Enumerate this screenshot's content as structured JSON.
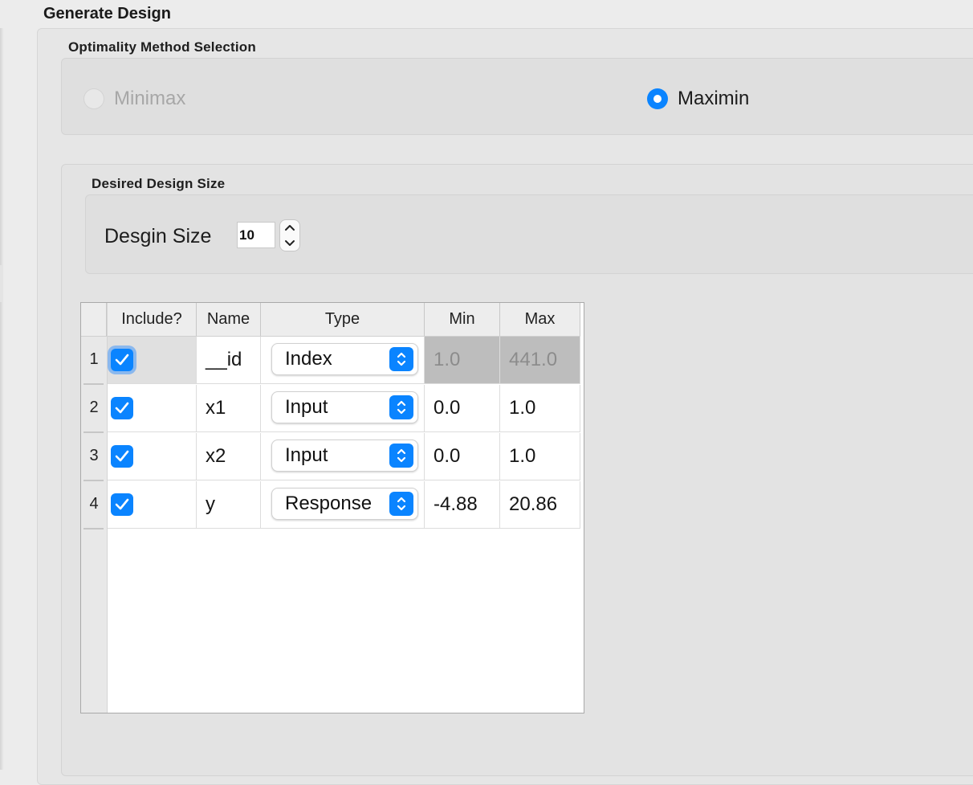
{
  "title": "Generate Design",
  "optimality": {
    "label": "Optimality Method Selection",
    "options": [
      {
        "label": "Minimax",
        "selected": false,
        "enabled": false
      },
      {
        "label": "Maximin",
        "selected": true,
        "enabled": true
      }
    ]
  },
  "design_size": {
    "group_label": "Desired Design Size",
    "field_label": "Desgin Size",
    "value": "10"
  },
  "table": {
    "columns": [
      "Include?",
      "Name",
      "Type",
      "Min",
      "Max"
    ],
    "rows": [
      {
        "num": "1",
        "include": true,
        "name": "__id",
        "type": "Index",
        "min": "1.0",
        "max": "441.0",
        "editable": false
      },
      {
        "num": "2",
        "include": true,
        "name": "x1",
        "type": "Input",
        "min": "0.0",
        "max": "1.0",
        "editable": true
      },
      {
        "num": "3",
        "include": true,
        "name": "x2",
        "type": "Input",
        "min": "0.0",
        "max": "1.0",
        "editable": true
      },
      {
        "num": "4",
        "include": true,
        "name": "y",
        "type": "Response",
        "min": "-4.88",
        "max": "20.86",
        "editable": true
      }
    ]
  },
  "colors": {
    "accent": "#0a84ff",
    "panel": "#e6e6e6",
    "disabled_text": "#a7a7a7"
  }
}
